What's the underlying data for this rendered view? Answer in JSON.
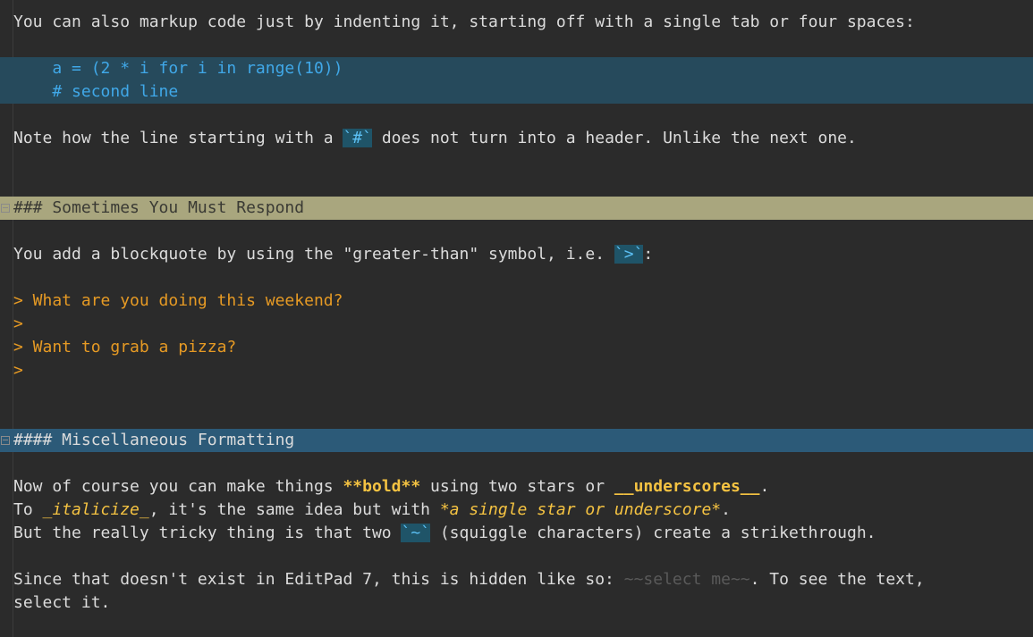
{
  "editor": {
    "app": "EditPad 7",
    "lines": {
      "l1": "You can also markup code just by indenting it, starting off with a single tab or four spaces:",
      "code1": "    a = (2 * i for i in range(10))",
      "code2": "    # second line",
      "l4a": "Note how the line starting with a ",
      "l4code": "`#`",
      "l4b": " does not turn into a header. Unlike the next one.",
      "h3": "### Sometimes You Must Respond",
      "l6a": "You add a blockquote by using the \"greater-than\" symbol, i.e. ",
      "l6code": "`>`",
      "l6b": ":",
      "q1": "> What are you doing this weekend?",
      "q2": ">",
      "q3": "> Want to grab a pizza?",
      "q4": ">",
      "h4": "#### Miscellaneous Formatting",
      "m1a": "Now of course you can make things ",
      "m1bold": "**bold**",
      "m1b": " using two stars or ",
      "m1under": "__underscores__",
      "m1c": ".",
      "m2a": "To ",
      "m2ital": "_italicize_",
      "m2b": ", it's the same idea but with ",
      "m2ital2": "*a single star or underscore*",
      "m2c": ".",
      "m3a": "But the really tricky thing is that two ",
      "m3code": "`~`",
      "m3b": " (squiggle characters) create a strikethrough.",
      "s1a": "Since that doesn't exist in EditPad 7, this is hidden like so: ",
      "s1hidden": "~~select me~~",
      "s1b": ". To see the text,",
      "s2": "select it."
    }
  },
  "colors": {
    "background": "#2b2b2b",
    "code_block_bg": "#264a5c",
    "h3_bg": "#a9a67e",
    "h4_bg": "#2c5a78",
    "quote_text": "#e69a24",
    "emphasis_text": "#f5c342",
    "code_text": "#40a8e8"
  }
}
